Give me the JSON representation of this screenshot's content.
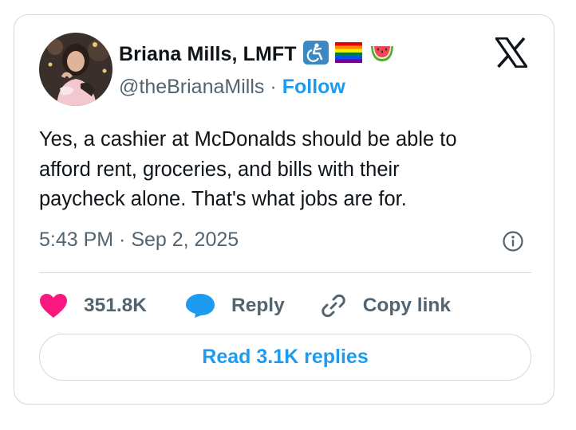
{
  "author": {
    "display_name": "Briana Mills, LMFT",
    "handle": "@theBrianaMills",
    "separator": "·",
    "follow_label": "Follow",
    "badges": [
      "wheelchair-icon",
      "rainbow-flag-icon",
      "watermelon-icon"
    ]
  },
  "tweet": {
    "text": "Yes, a cashier at McDonalds should be able to\nafford rent, groceries, and bills with their\npaycheck alone. That's what jobs are for.",
    "timestamp": "5:43 PM · Sep 2, 2025"
  },
  "actions": {
    "likes": "351.8K",
    "reply_label": "Reply",
    "copy_link_label": "Copy link"
  },
  "read_replies_label": "Read 3.1K replies",
  "colors": {
    "accent": "#1d9bf0",
    "like": "#f91880",
    "secondary_text": "#536471",
    "border": "#cfd9de"
  }
}
